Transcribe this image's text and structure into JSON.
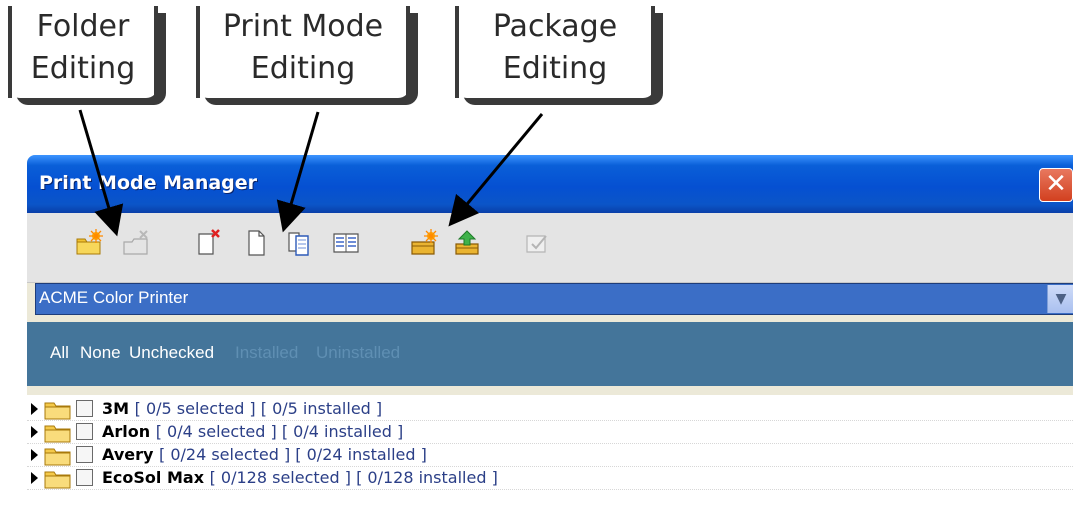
{
  "callouts": {
    "folder": {
      "line1": "Folder",
      "line2": "Editing"
    },
    "print_mode": {
      "line1": "Print Mode",
      "line2": "Editing"
    },
    "package": {
      "line1": "Package",
      "line2": "Editing"
    }
  },
  "window": {
    "title": "Print Mode Manager",
    "close_label": "✕"
  },
  "toolbar": {
    "buttons": [
      {
        "icon": "new-folder-icon",
        "enabled": true
      },
      {
        "icon": "delete-folder-icon",
        "enabled": false
      },
      {
        "icon": "delete-print-mode-icon",
        "enabled": true
      },
      {
        "icon": "new-print-mode-icon",
        "enabled": true
      },
      {
        "icon": "copy-print-mode-icon",
        "enabled": true
      },
      {
        "icon": "print-mode-properties-icon",
        "enabled": true
      },
      {
        "icon": "new-package-icon",
        "enabled": true
      },
      {
        "icon": "install-package-icon",
        "enabled": true
      },
      {
        "icon": "apply-icon",
        "enabled": false
      }
    ]
  },
  "printer_select": {
    "value": "ACME Color Printer"
  },
  "filters": {
    "all": "All",
    "none": "None",
    "unchecked": "Unchecked",
    "installed": "Installed",
    "uninstalled": "Uninstalled"
  },
  "tree": {
    "items": [
      {
        "name": "3M",
        "info": "[ 0/5 selected ]  [ 0/5 installed ]"
      },
      {
        "name": "Arlon",
        "info": "[ 0/4 selected ]  [ 0/4 installed ]"
      },
      {
        "name": "Avery",
        "info": "[ 0/24 selected ]  [ 0/24 installed ]"
      },
      {
        "name": "EcoSol Max",
        "info": "[ 0/128 selected ]  [ 0/128 installed ]"
      }
    ]
  },
  "colors": {
    "titlebar": "#0550d2",
    "filterbar": "#44759a",
    "select_highlight": "#3b6ec6"
  }
}
